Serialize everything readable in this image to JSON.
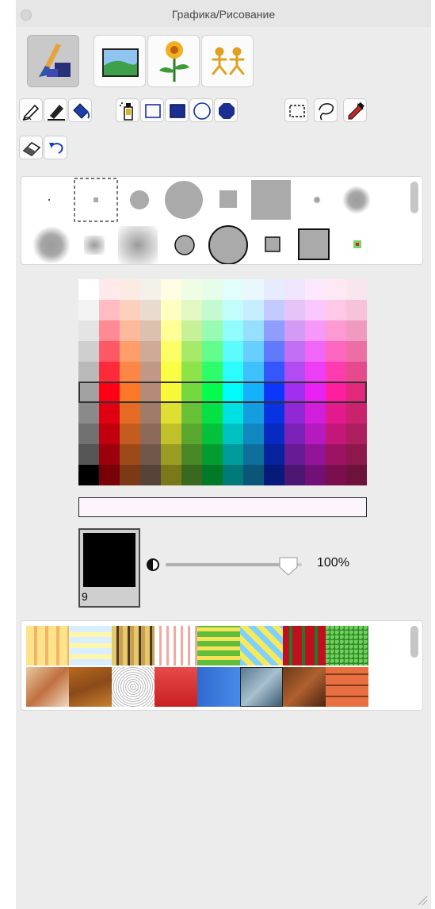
{
  "window": {
    "title": "Графика/Рисование"
  },
  "modes": [
    {
      "name": "paint-mode",
      "icon": "brush-paint-icon",
      "selected": true
    },
    {
      "name": "picture-mode",
      "icon": "landscape-picture-icon",
      "selected": false
    },
    {
      "name": "sticker-mode",
      "icon": "flower-sticker-icon",
      "selected": false
    },
    {
      "name": "animation-mode",
      "icon": "walking-figures-icon",
      "selected": false
    }
  ],
  "tools": [
    "pencil-icon",
    "marker-icon",
    "paint-bucket-icon",
    "spray-can-icon",
    "rectangle-outline-icon",
    "rectangle-filled-icon",
    "ellipse-outline-icon",
    "ellipse-filled-icon",
    "rectangle-select-icon",
    "lasso-icon",
    "eyedropper-icon",
    "eraser-icon",
    "undo-icon"
  ],
  "brushes": [
    "dot-tiny",
    "dot-small-selected",
    "circle-soft-medium",
    "circle-large",
    "square-medium",
    "square-large",
    "dot-soft-small",
    "circle-blur-medium",
    "circle-blur-large",
    "square-blur-small",
    "square-blur-large",
    "circle-outline-medium",
    "circle-outline-large",
    "square-outline-small",
    "square-outline-large",
    "dot-red-green"
  ],
  "colors": {
    "rows": [
      [
        "#ffffff",
        "#ffe9ea",
        "#fcebe3",
        "#f3f1ea",
        "#fdfde4",
        "#effde5",
        "#e6fdea",
        "#e3fdfb",
        "#e8f8fd",
        "#e6ecfd",
        "#eee6fd",
        "#fbe8fd",
        "#fde8f4",
        "#f9e5ee"
      ],
      [
        "#f3f3f3",
        "#ffbcc2",
        "#fbd1bd",
        "#eadbd0",
        "#fefec0",
        "#e1f7c4",
        "#c5f9d1",
        "#c3fdfb",
        "#c6eefe",
        "#c3cafd",
        "#e5c5f8",
        "#f8c7fb",
        "#fec8e6",
        "#f7c3da"
      ],
      [
        "#e4e4e4",
        "#fe8b93",
        "#fdb99b",
        "#dcc0b0",
        "#feff96",
        "#c6f199",
        "#97fbb1",
        "#90fdfc",
        "#97dffe",
        "#8f9dfc",
        "#d39af6",
        "#f598f9",
        "#fe9ad3",
        "#f19abf"
      ],
      [
        "#cfcfcf",
        "#fe5a66",
        "#fd9e6b",
        "#ceaa97",
        "#fdfe66",
        "#a7ea6a",
        "#62fd8d",
        "#5dfcfc",
        "#66cffd",
        "#6179fb",
        "#c26ff4",
        "#f066f7",
        "#fe66c0",
        "#ec6ea5"
      ],
      [
        "#b9b9b9",
        "#fd2b3a",
        "#fc8644",
        "#c19785",
        "#fbfd45",
        "#8ce34a",
        "#2efc6a",
        "#2cfcfc",
        "#3dc0fc",
        "#3457fb",
        "#b24bf2",
        "#ed3ef6",
        "#fe3cae",
        "#e64a8d"
      ],
      [
        "#a2a2a2",
        "#fd0013",
        "#fc7828",
        "#b58a78",
        "#f7f938",
        "#74d93e",
        "#05fb4d",
        "#00fbfb",
        "#16b1fb",
        "#0a37fa",
        "#a22ef0",
        "#ea21f5",
        "#fe1e9f",
        "#e1287a"
      ],
      [
        "#8a8a8a",
        "#df0011",
        "#e36b23",
        "#a17b6a",
        "#dedf32",
        "#68c237",
        "#05e145",
        "#00e1e1",
        "#149ee0",
        "#0932e0",
        "#9128d6",
        "#d11edb",
        "#e21a8d",
        "#c9236d"
      ],
      [
        "#717171",
        "#c0000e",
        "#c35c1e",
        "#8b6a5b",
        "#bfc02a",
        "#59a72f",
        "#04c13c",
        "#00c1c1",
        "#1188c0",
        "#072ac0",
        "#7d22b8",
        "#b41abd",
        "#c31779",
        "#ad1e5e"
      ],
      [
        "#555555",
        "#9b000c",
        "#9e4a18",
        "#71564a",
        "#9b9c22",
        "#488826",
        "#039c31",
        "#009c9c",
        "#0e6e9c",
        "#06229c",
        "#651c95",
        "#921599",
        "#9e1262",
        "#8c184c"
      ],
      [
        "#000000",
        "#780009",
        "#7b3a13",
        "#584339",
        "#79791a",
        "#38691e",
        "#027926",
        "#007979",
        "#0b5579",
        "#051a79",
        "#4e1673",
        "#711077",
        "#7b0e4c",
        "#6d133b"
      ]
    ],
    "selected_row": 5,
    "current_field": "#fcf5fb"
  },
  "brush_color": {
    "color": "#000000",
    "size_label": "9"
  },
  "opacity": {
    "value": 0.9,
    "label": "100%"
  },
  "patterns": [
    "yellow-plaid",
    "blue-yellow-plaid",
    "dark-plaid",
    "pink-plaid",
    "green-plaid",
    "blue-argyle",
    "red-tartan",
    "green-grass",
    "sand-texture",
    "rust-texture",
    "gravel-texture",
    "red-fabric",
    "blue-gradient",
    "blue-stone",
    "brown-rock",
    "brick-wall"
  ]
}
